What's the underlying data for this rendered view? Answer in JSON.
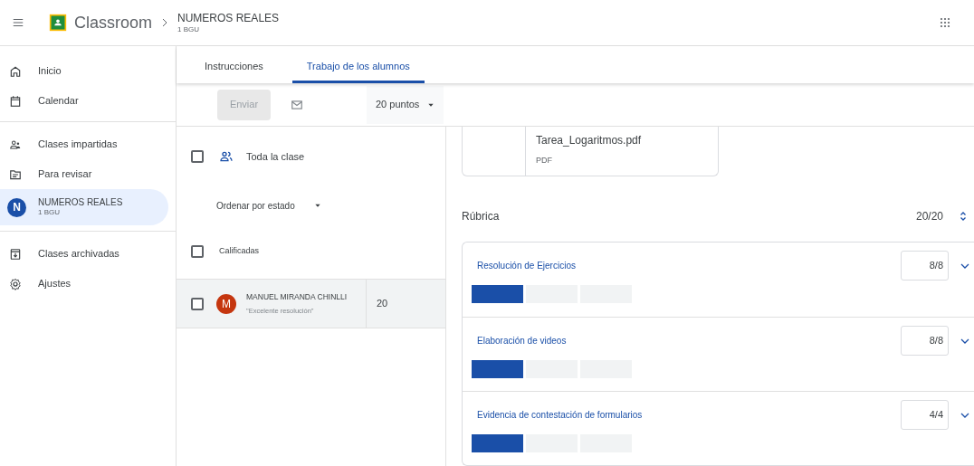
{
  "header": {
    "app_name": "Classroom",
    "course_title": "NUMEROS REALES",
    "course_subtitle": "1 BGU"
  },
  "sidebar": {
    "groups": [
      [
        {
          "kind": "link",
          "label": "Inicio",
          "selected": false
        },
        {
          "kind": "link",
          "label": "Calendar",
          "selected": false
        }
      ],
      [
        {
          "kind": "link",
          "label": "Clases impartidas",
          "selected": false
        },
        {
          "kind": "link",
          "label": "Para revisar",
          "selected": false
        },
        {
          "kind": "course",
          "avatar": "N",
          "label": "NUMEROS REALES",
          "sublabel": "1 BGU",
          "selected": true
        }
      ],
      [
        {
          "kind": "link",
          "label": "Clases archivadas",
          "selected": false
        },
        {
          "kind": "link",
          "label": "Ajustes",
          "selected": false
        }
      ]
    ]
  },
  "tabs": [
    {
      "label": "Instrucciones",
      "selected": false
    },
    {
      "label": "Trabajo de los alumnos",
      "selected": true
    }
  ],
  "toolbar": {
    "send_button": {
      "label": "Enviar",
      "disabled": true
    },
    "points": "20 puntos"
  },
  "students": {
    "all": {
      "label": "Toda la clase",
      "checked": false
    },
    "sort": "Ordenar por estado",
    "group": {
      "label": "Calificadas",
      "checked": false
    },
    "rows": [
      {
        "avatar": "M",
        "name": "MANUEL MIRANDA CHINLLI",
        "comment": "\"Excelente resolución\"",
        "grade": "20",
        "checked": false,
        "selected": true
      }
    ]
  },
  "attachment": {
    "name": "Tarea_Logaritmos.pdf",
    "type": "PDF"
  },
  "rubric": {
    "title": "Rúbrica",
    "total": "20/20",
    "criteria": [
      {
        "name": "Resolución de Ejercicios",
        "score": "8/8",
        "levels": [
          {
            "selected": true
          },
          {
            "selected": false
          },
          {
            "selected": false
          }
        ]
      },
      {
        "name": "Elaboración de videos",
        "score": "8/8",
        "levels": [
          {
            "selected": true
          },
          {
            "selected": false
          },
          {
            "selected": false
          }
        ]
      },
      {
        "name": "Evidencia de contestación de formularios",
        "score": "4/4",
        "levels": [
          {
            "selected": true
          },
          {
            "selected": false
          },
          {
            "selected": false
          }
        ]
      }
    ]
  }
}
